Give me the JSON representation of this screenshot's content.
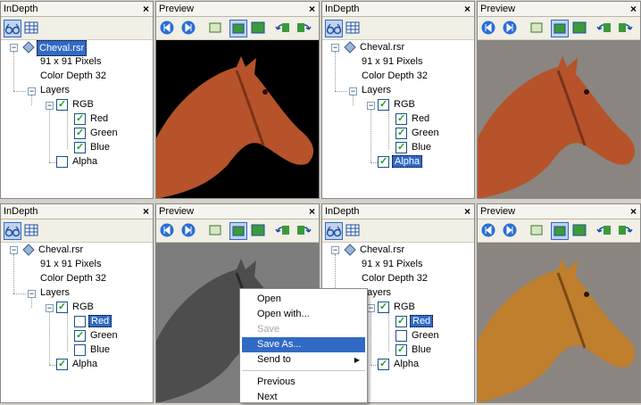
{
  "indepth_title": "InDepth",
  "preview_title": "Preview",
  "close_glyph": "×",
  "tree": {
    "file": "Cheval.rsr",
    "size": "91 x 91 Pixels",
    "depth": "Color Depth 32",
    "layers": "Layers",
    "rgb": "RGB",
    "red": "Red",
    "green": "Green",
    "blue": "Blue",
    "alpha": "Alpha"
  },
  "panels": [
    {
      "red": true,
      "green": true,
      "blue": true,
      "alpha": false,
      "selected": "file",
      "horse_color": "#b6532a",
      "bg": "#000000"
    },
    {
      "red": true,
      "green": true,
      "blue": true,
      "alpha": true,
      "selected": "alpha",
      "horse_color": "#b6532a",
      "bg": "#8a8580"
    },
    {
      "red": false,
      "green": true,
      "blue": false,
      "alpha": true,
      "selected": "red",
      "horse_color": "#4d4d4d",
      "bg": "#7d7d7d"
    },
    {
      "red": true,
      "green": false,
      "blue": true,
      "alpha": true,
      "selected": "red",
      "horse_color": "#c07f2d",
      "bg": "#8a8580"
    }
  ],
  "context_menu": {
    "open": "Open",
    "open_with": "Open with...",
    "save": "Save",
    "save_as": "Save As...",
    "send_to": "Send to",
    "previous": "Previous",
    "next": "Next"
  },
  "colors": {
    "selection": "#316ac5",
    "check": "#21a121"
  }
}
